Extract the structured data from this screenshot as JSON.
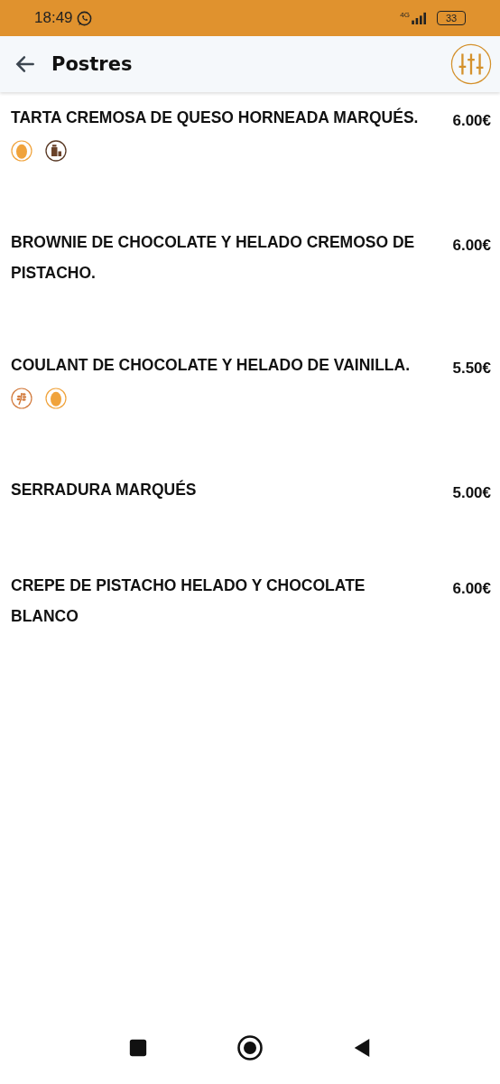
{
  "status_bar": {
    "time": "18:49",
    "network": "4G",
    "battery": "33"
  },
  "app_bar": {
    "title": "Postres"
  },
  "items": [
    {
      "name": "TARTA CREMOSA DE QUESO HORNEADA MARQUÉS.",
      "price": "6.00€",
      "allergens": [
        {
          "kind": "egg"
        },
        {
          "kind": "milk"
        }
      ]
    },
    {
      "name": "BROWNIE DE CHOCOLATE Y HELADO CREMOSO DE PISTACHO.",
      "price": "6.00€"
    },
    {
      "name": "COULANT DE CHOCOLATE Y HELADO DE VAINILLA.",
      "price": "5.50€",
      "allergens": [
        {
          "kind": "gluten"
        },
        {
          "kind": "egg"
        }
      ]
    },
    {
      "name": "SERRADURA MARQUÉS",
      "price": "5.00€"
    },
    {
      "name": "CREPE DE PISTACHO HELADO Y CHOCOLATE BLANCO",
      "price": "6.00€"
    }
  ]
}
